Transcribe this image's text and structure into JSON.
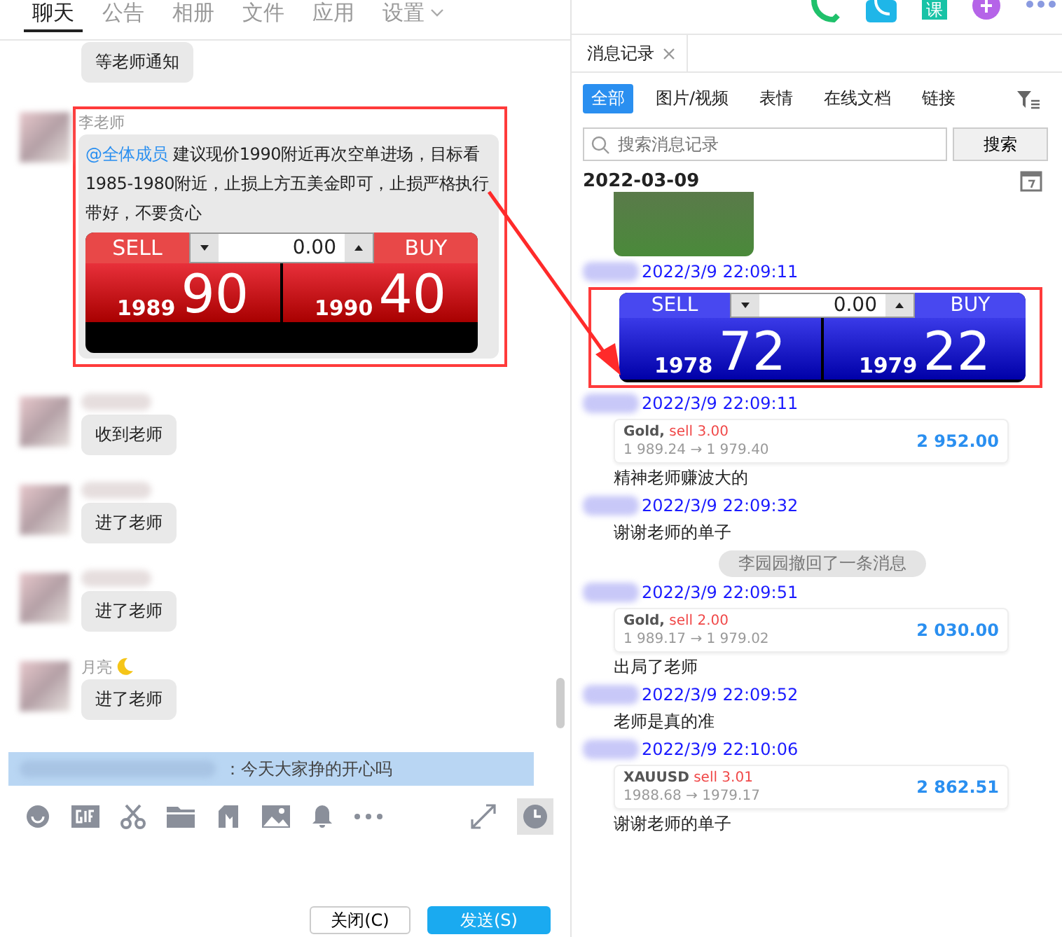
{
  "nav_tabs": [
    {
      "label": "聊天",
      "selected": true,
      "dropdown": false
    },
    {
      "label": "公告",
      "selected": false,
      "dropdown": false
    },
    {
      "label": "相册",
      "selected": false,
      "dropdown": false
    },
    {
      "label": "文件",
      "selected": false,
      "dropdown": false
    },
    {
      "label": "应用",
      "selected": false,
      "dropdown": false
    },
    {
      "label": "设置",
      "selected": false,
      "dropdown": true
    }
  ],
  "header": {
    "course_label": "课"
  },
  "chat": {
    "messages": [
      {
        "continued": true,
        "text": "等老师通知"
      },
      {
        "continued": false,
        "sender": "李老师",
        "highlighted": true,
        "mention": "@全体成员",
        "text": "建议现价1990附近再次空单进场，目标看1985-1980附近，止损上方五美金即可，止损严格执行带好，不要贪心",
        "signal": {
          "kind": "red",
          "sell_label": "SELL",
          "buy_label": "BUY",
          "volume": "0.00",
          "sell_small": "1989",
          "sell_big": "90",
          "buy_small": "1990",
          "buy_big": "40"
        }
      },
      {
        "continued": false,
        "text": "收到老师"
      },
      {
        "continued": false,
        "text": "进了老师"
      },
      {
        "continued": false,
        "text": "进了老师"
      },
      {
        "continued": false,
        "sender": "月亮",
        "moon": true,
        "text": "进了老师"
      }
    ],
    "quote": "：今天大家挣的开心吗",
    "history_active": true,
    "buttons": [
      {
        "label": "关闭(C)",
        "kind": "default"
      },
      {
        "label": "发送(S)",
        "kind": "primary"
      }
    ]
  },
  "history": {
    "tab": "消息记录",
    "filters": [
      {
        "label": "全部",
        "selected": true
      },
      {
        "label": "图片/视频",
        "selected": false
      },
      {
        "label": "表情",
        "selected": false
      },
      {
        "label": "在线文档",
        "selected": false
      },
      {
        "label": "链接",
        "selected": false
      }
    ],
    "search": {
      "placeholder": "搜索消息记录",
      "button": "搜索"
    },
    "date": "2022-03-09",
    "entries": [
      {
        "kind": "photo"
      },
      {
        "kind": "signal",
        "time": "2022/3/9 22:09:11",
        "highlighted": true,
        "signal": {
          "kind": "blue",
          "sell_label": "SELL",
          "buy_label": "BUY",
          "volume": "0.00",
          "sell_small": "1978",
          "sell_big": "72",
          "buy_small": "1979",
          "buy_big": "22"
        }
      },
      {
        "kind": "trade",
        "time": "2022/3/9 22:09:11",
        "trade": {
          "symbol": "Gold,",
          "action": "sell 3.00",
          "route": "1 989.24 → 1 979.40",
          "profit": "2 952.00"
        },
        "text": "精神老师赚波大的"
      },
      {
        "kind": "text",
        "time": "2022/3/9 22:09:32",
        "text": "谢谢老师的单子"
      },
      {
        "kind": "system",
        "text": "李园园撤回了一条消息"
      },
      {
        "kind": "trade",
        "time": "2022/3/9 22:09:51",
        "trade": {
          "symbol": "Gold,",
          "action": "sell 2.00",
          "route": "1 989.17 → 1 979.02",
          "profit": "2 030.00"
        },
        "text": "出局了老师"
      },
      {
        "kind": "text",
        "time": "2022/3/9 22:09:52",
        "text": "老师是真的准"
      },
      {
        "kind": "trade",
        "time": "2022/3/9 22:10:06",
        "trade": {
          "symbol": "XAUUSD",
          "action": "sell 3.01",
          "route": "1988.68 → 1979.17",
          "profit": "2 862.51"
        },
        "text": "谢谢老师的单子"
      }
    ]
  },
  "annotation": {
    "arrow": true
  }
}
